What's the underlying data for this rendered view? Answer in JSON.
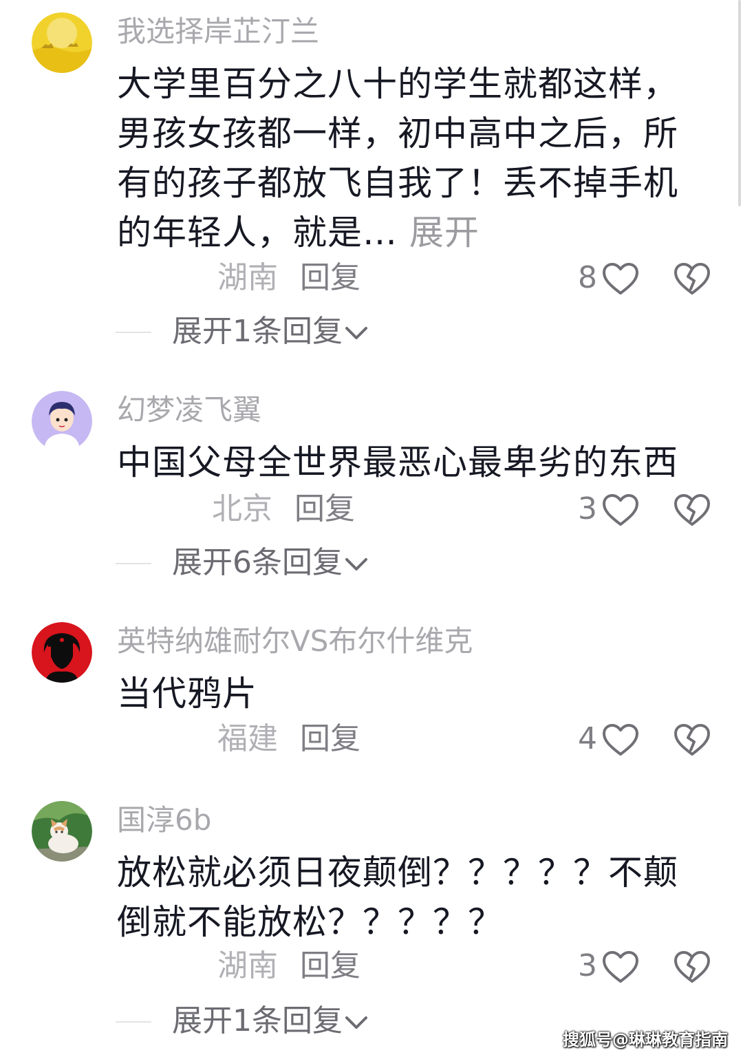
{
  "comments": [
    {
      "username": "我选择岸芷汀兰",
      "content": "大学里百分之八十的学生就都这样，男孩女孩都一样，初中高中之后，所有的孩子都放飞自我了！丢不掉手机的年轻人，就是…",
      "expand_label": " 展开",
      "location": "湖南",
      "reply_label": "回复",
      "likes": "8",
      "expand_replies_label": "展开1条回复"
    },
    {
      "username": "幻梦凌飞翼",
      "content": "中国父母全世界最恶心最卑劣的东西",
      "location": "北京",
      "reply_label": "回复",
      "likes": "3",
      "expand_replies_label": "展开6条回复"
    },
    {
      "username": "英特纳雄耐尔VS布尔什维克",
      "content": "当代鸦片",
      "location": "福建",
      "reply_label": "回复",
      "likes": "4"
    },
    {
      "username": "国淳6b",
      "content": "放松就必须日夜颠倒？？？？？不颠倒就不能放松？？？？？",
      "location": "湖南",
      "reply_label": "回复",
      "likes": "3",
      "expand_replies_label": "展开1条回复"
    }
  ],
  "watermark": "搜狐号@琳琳教育指南",
  "icons": {
    "like": "heart-outline-icon",
    "dislike": "broken-heart-icon",
    "expand": "chevron-down-icon"
  },
  "colors": {
    "text": "#161823",
    "username": "#a8a8ad",
    "secondary": "#7e7e84"
  }
}
